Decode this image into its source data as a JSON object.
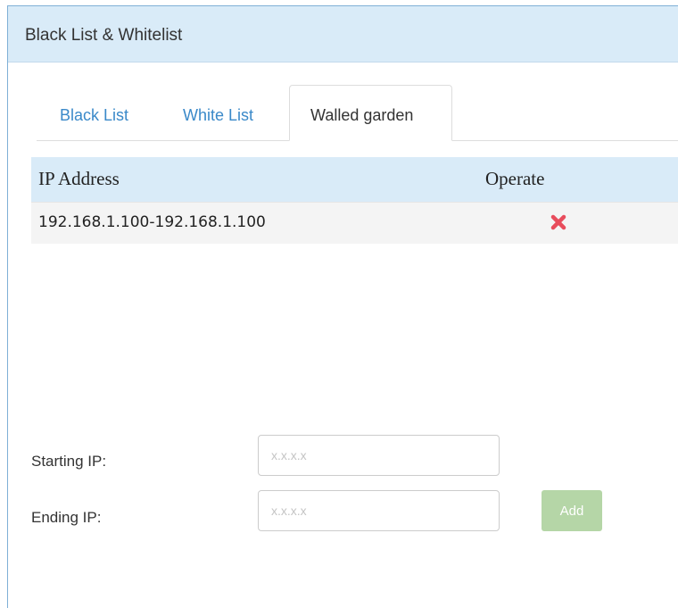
{
  "panel": {
    "title": "Black List & Whitelist"
  },
  "tabs": [
    {
      "label": "Black List",
      "active": false
    },
    {
      "label": "White List",
      "active": false
    },
    {
      "label": "Walled garden",
      "active": true
    }
  ],
  "table": {
    "columns": [
      "IP Address",
      "Operate"
    ],
    "rows": [
      {
        "ip_range": "192.168.1.100-192.168.1.100",
        "operate_icon": "delete-x-icon"
      }
    ]
  },
  "form": {
    "starting_ip_label": "Starting IP:",
    "starting_ip_placeholder": "x.x.x.x",
    "starting_ip_value": "",
    "ending_ip_label": "Ending IP:",
    "ending_ip_placeholder": "x.x.x.x",
    "ending_ip_value": "",
    "add_label": "Add"
  },
  "colors": {
    "header_bg": "#d9ebf8",
    "tab_link": "#3a89c9",
    "delete_icon": "#e84c5c",
    "add_button": "#b5d6a7"
  }
}
